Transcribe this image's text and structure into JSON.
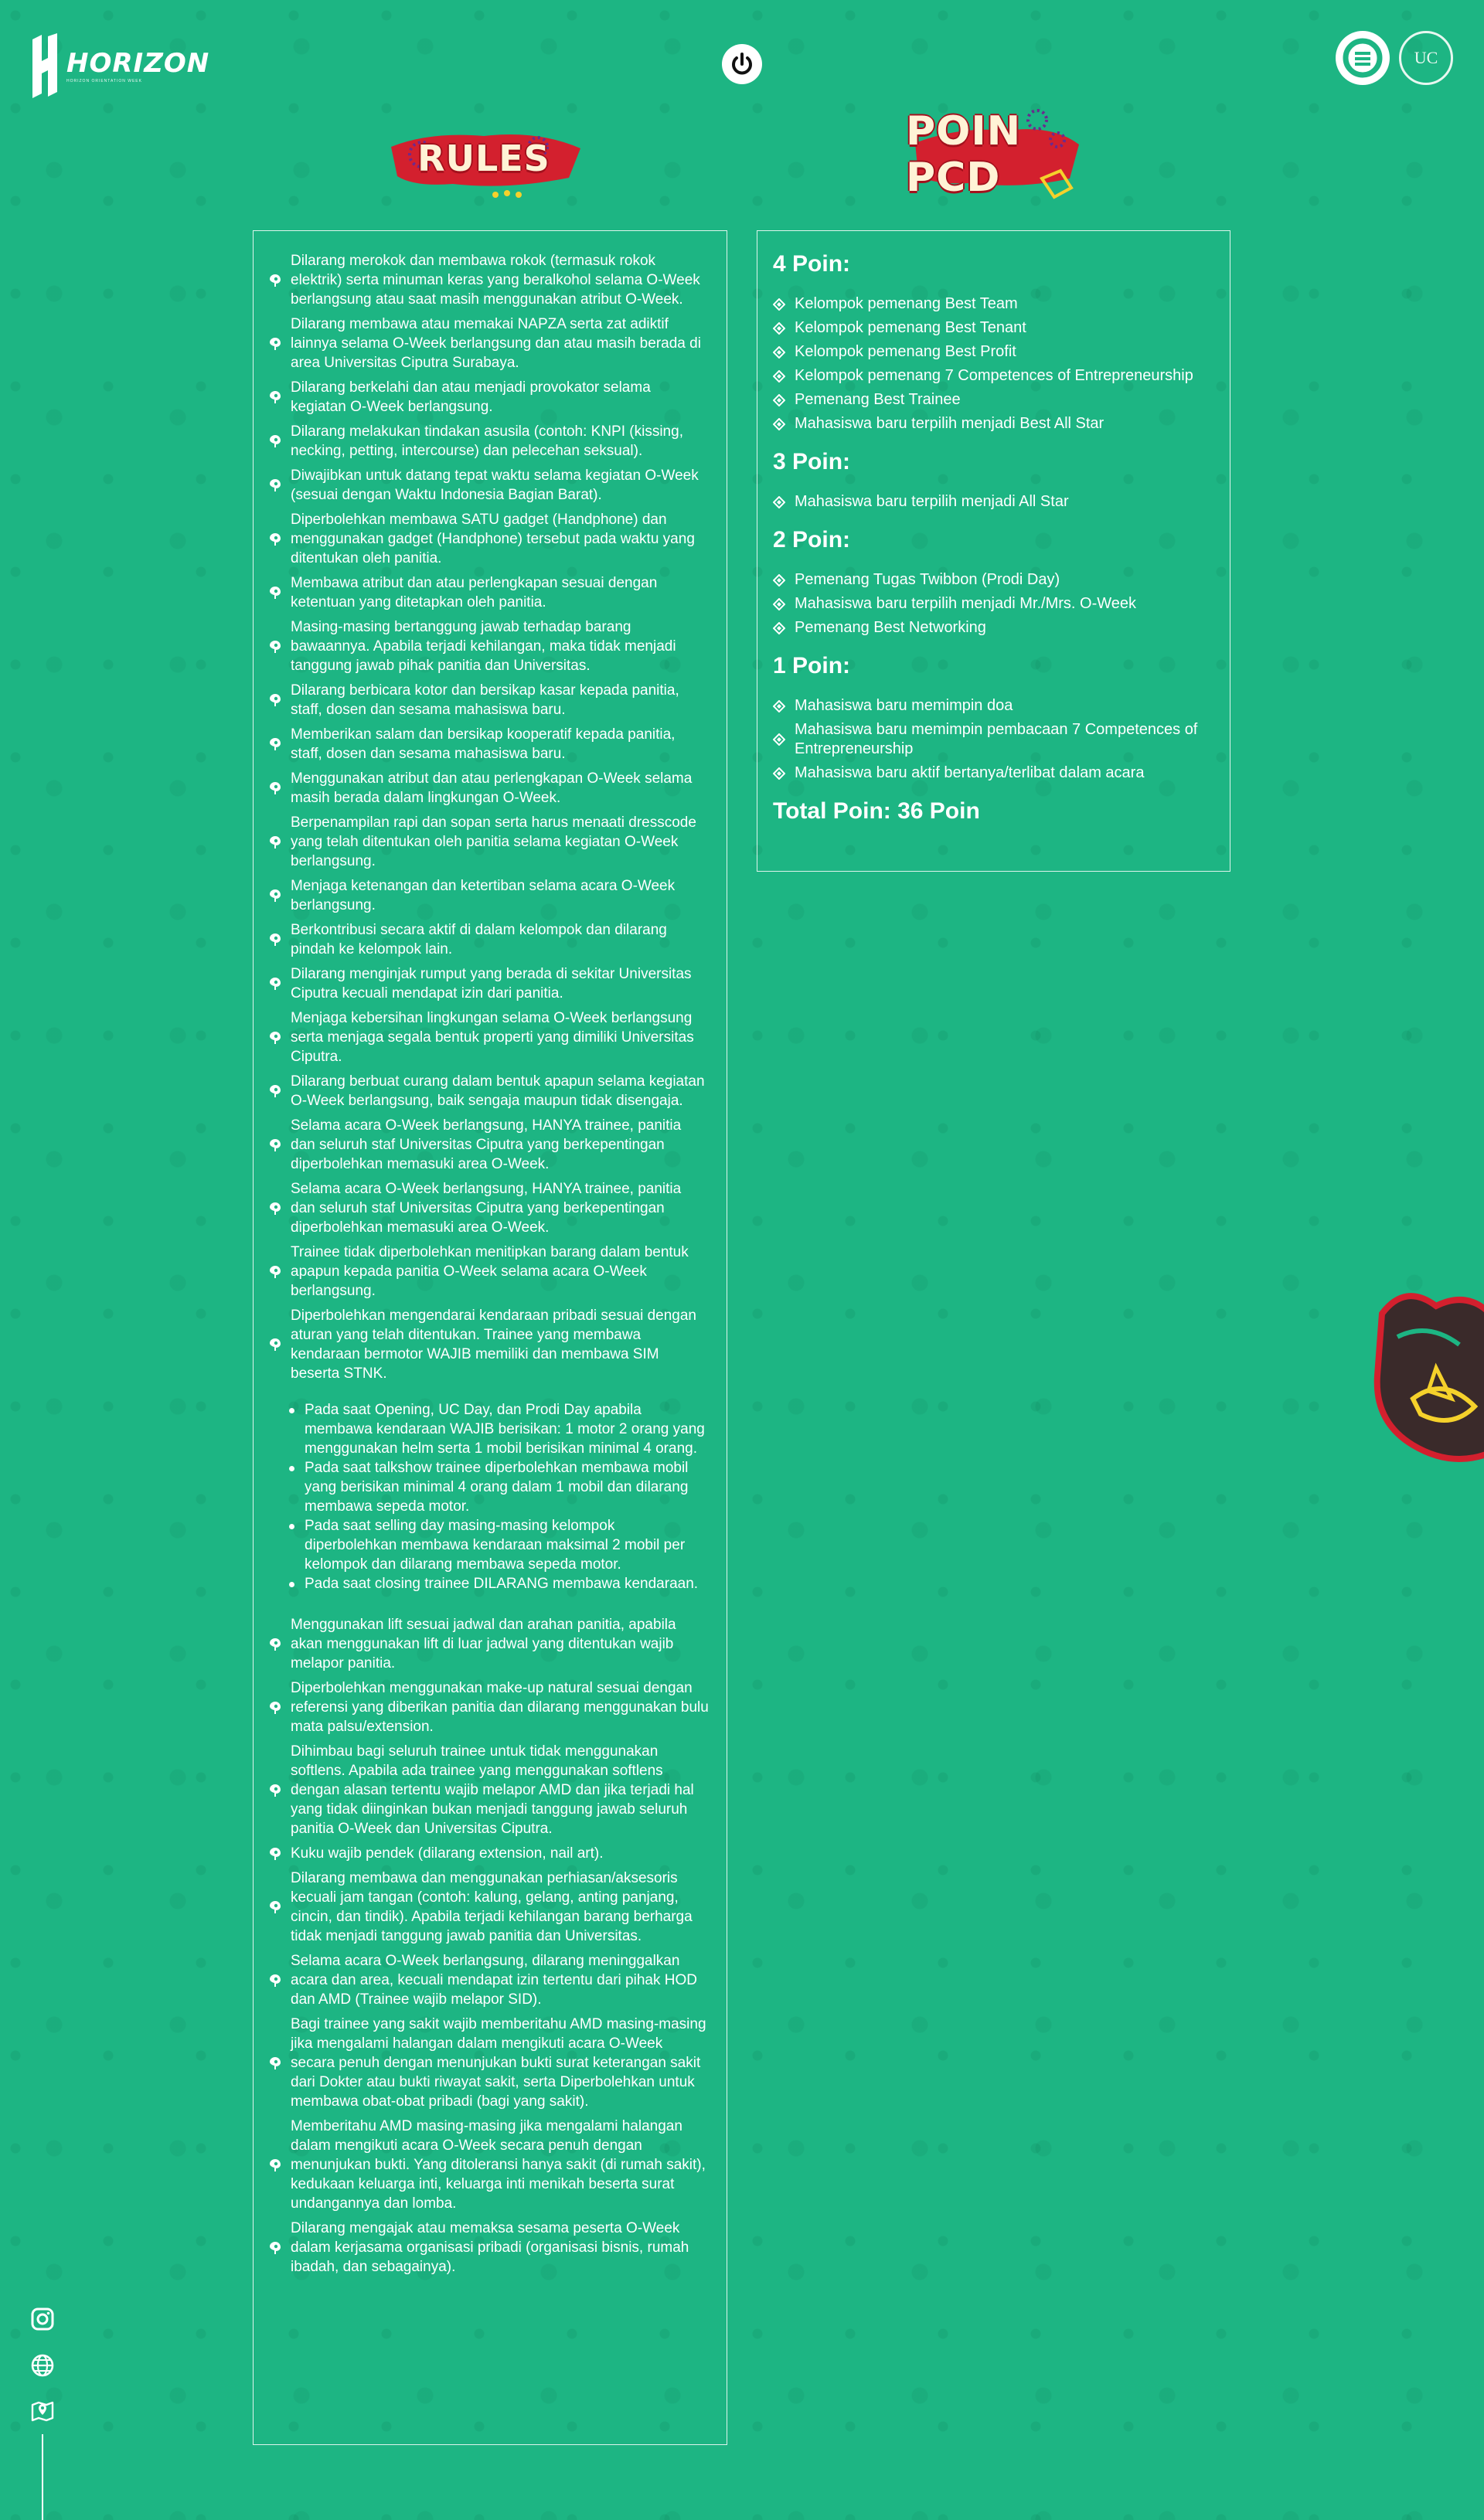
{
  "header": {
    "logo_text": "HORIZON",
    "logo_subtext": "HORIZON ORIENTATION WEEK",
    "right_logo_2_text": "UC"
  },
  "colors": {
    "background": "#1db583",
    "badge_red": "#d3202e",
    "badge_cream": "#fff3d6",
    "accent_yellow": "#f5d12b",
    "accent_purple": "#6b2a8f"
  },
  "titles": {
    "rules": "RULES",
    "poin": "POIN PCD"
  },
  "rules": [
    "Dilarang merokok dan membawa rokok (termasuk rokok elektrik) serta minuman keras yang beralkohol selama O-Week berlangsung atau saat masih menggunakan atribut O-Week.",
    "Dilarang membawa atau memakai NAPZA serta zat adiktif lainnya selama O-Week berlangsung dan atau masih berada di area Universitas Ciputra Surabaya.",
    "Dilarang berkelahi dan atau menjadi provokator selama kegiatan O-Week berlangsung.",
    "Dilarang melakukan tindakan asusila (contoh: KNPI (kissing, necking, petting, intercourse) dan pelecehan seksual).",
    "Diwajibkan untuk datang tepat waktu selama kegiatan O-Week (sesuai dengan Waktu Indonesia Bagian Barat).",
    "Diperbolehkan membawa SATU gadget (Handphone) dan menggunakan gadget (Handphone) tersebut pada waktu yang ditentukan oleh panitia.",
    "Membawa atribut dan atau perlengkapan sesuai dengan ketentuan yang ditetapkan oleh panitia.",
    "Masing-masing bertanggung jawab terhadap barang bawaannya. Apabila terjadi kehilangan, maka tidak menjadi tanggung jawab pihak panitia dan Universitas.",
    "Dilarang berbicara kotor dan bersikap kasar kepada panitia, staff, dosen dan sesama mahasiswa baru.",
    "Memberikan salam dan bersikap kooperatif kepada panitia, staff, dosen dan sesama mahasiswa baru.",
    "Menggunakan atribut dan atau perlengkapan O-Week selama masih berada dalam lingkungan O-Week.",
    "Berpenampilan rapi dan sopan serta harus menaati dresscode yang telah ditentukan oleh panitia selama kegiatan O-Week berlangsung.",
    "Menjaga ketenangan dan ketertiban selama acara O-Week berlangsung.",
    "Berkontribusi secara aktif di dalam kelompok dan dilarang pindah ke kelompok lain.",
    "Dilarang menginjak rumput yang berada di sekitar Universitas Ciputra kecuali mendapat izin dari panitia.",
    "Menjaga kebersihan lingkungan selama O-Week berlangsung serta menjaga segala bentuk properti yang dimiliki Universitas Ciputra.",
    "Dilarang berbuat curang dalam bentuk apapun selama kegiatan O-Week berlangsung, baik sengaja maupun tidak disengaja.",
    "Selama acara O-Week berlangsung, HANYA trainee, panitia dan seluruh staf Universitas Ciputra yang berkepentingan diperbolehkan memasuki area O-Week.",
    "Selama acara O-Week berlangsung, HANYA trainee, panitia dan seluruh staf Universitas Ciputra yang berkepentingan diperbolehkan memasuki area O-Week.",
    "Trainee tidak diperbolehkan menitipkan barang dalam bentuk apapun kepada panitia O-Week selama acara O-Week berlangsung.",
    "Diperbolehkan mengendarai kendaraan pribadi sesuai dengan aturan yang telah ditentukan. Trainee yang membawa kendaraan bermotor WAJIB memiliki dan membawa SIM beserta STNK."
  ],
  "rules_sublist": [
    "Pada saat Opening, UC Day, dan Prodi Day apabila membawa kendaraan WAJIB berisikan: 1 motor 2 orang yang menggunakan helm serta 1 mobil berisikan minimal 4 orang.",
    "Pada saat talkshow trainee diperbolehkan membawa mobil yang berisikan minimal 4 orang dalam 1 mobil dan dilarang membawa sepeda motor.",
    "Pada saat selling day masing-masing kelompok diperbolehkan membawa kendaraan maksimal 2 mobil per kelompok dan dilarang membawa sepeda motor.",
    "Pada saat closing trainee DILARANG membawa kendaraan."
  ],
  "rules_after": [
    "Menggunakan lift sesuai jadwal dan arahan panitia, apabila akan menggunakan lift di luar jadwal yang ditentukan wajib melapor panitia.",
    "Diperbolehkan menggunakan make-up natural sesuai dengan referensi yang diberikan panitia dan dilarang menggunakan bulu mata palsu/extension.",
    "Dihimbau bagi seluruh trainee untuk tidak menggunakan softlens. Apabila ada trainee yang menggunakan softlens dengan alasan tertentu wajib melapor AMD dan jika terjadi hal yang tidak diinginkan bukan menjadi tanggung jawab seluruh panitia O-Week dan Universitas Ciputra.",
    "Kuku wajib pendek (dilarang extension, nail art).",
    "Dilarang membawa dan menggunakan perhiasan/aksesoris kecuali jam tangan (contoh: kalung, gelang, anting panjang, cincin, dan tindik). Apabila terjadi kehilangan barang berharga tidak menjadi tanggung jawab panitia dan Universitas.",
    "Selama acara O-Week berlangsung, dilarang meninggalkan acara dan area, kecuali mendapat izin tertentu dari pihak HOD dan AMD (Trainee wajib melapor SID).",
    "Bagi trainee yang sakit wajib memberitahu AMD masing-masing jika mengalami halangan dalam mengikuti acara O-Week secara penuh dengan menunjukan bukti surat keterangan sakit dari Dokter atau bukti riwayat sakit, serta Diperbolehkan untuk membawa obat-obat pribadi (bagi yang sakit).",
    "Memberitahu AMD masing-masing jika mengalami halangan dalam mengikuti acara O-Week secara penuh dengan menunjukan bukti. Yang ditoleransi hanya sakit (di rumah sakit), kedukaan keluarga inti, keluarga inti menikah beserta surat undangannya dan lomba.",
    "Dilarang mengajak atau memaksa sesama peserta O-Week dalam kerjasama organisasi pribadi (organisasi bisnis, rumah ibadah, dan sebagainya)."
  ],
  "poin": {
    "groups": [
      {
        "heading": "4 Poin:",
        "items": [
          "Kelompok pemenang Best Team",
          "Kelompok pemenang Best Tenant",
          "Kelompok pemenang Best Profit",
          "Kelompok pemenang 7 Competences of Entrepreneurship",
          "Pemenang Best Trainee",
          "Mahasiswa baru terpilih menjadi Best All Star"
        ]
      },
      {
        "heading": "3 Poin:",
        "items": [
          "Mahasiswa baru terpilih menjadi All Star"
        ]
      },
      {
        "heading": "2 Poin:",
        "items": [
          "Pemenang Tugas Twibbon (Prodi Day)",
          "Mahasiswa baru terpilih menjadi Mr./Mrs. O-Week",
          "Pemenang Best Networking"
        ]
      },
      {
        "heading": "1 Poin:",
        "items": [
          "Mahasiswa baru memimpin doa",
          "Mahasiswa baru memimpin pembacaan 7 Competences of Entrepreneurship",
          "Mahasiswa baru aktif bertanya/terlibat dalam acara"
        ]
      }
    ],
    "total": "Total Poin: 36 Poin"
  },
  "social_icons": [
    "instagram-icon",
    "globe-icon",
    "map-icon"
  ]
}
